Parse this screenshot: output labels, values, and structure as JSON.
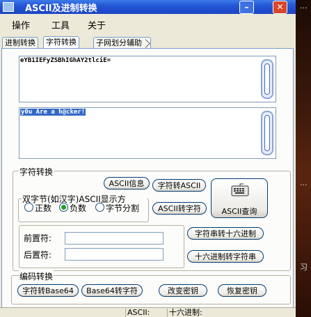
{
  "window": {
    "title": "ASCII及进制转换",
    "minimize_glyph": "–",
    "close_glyph": "✕",
    "accent": "#2457d6",
    "close_color": "#d9462a"
  },
  "menu": [
    "操作",
    "工具",
    "关于"
  ],
  "tabs": [
    {
      "label": "进制转换",
      "active": false
    },
    {
      "label": "字符转换",
      "active": true
    },
    {
      "label": "子网划分辅助",
      "active": false
    }
  ],
  "encoded_box": {
    "value": "eYB1IEFyZSBhIGhAY2tlciE="
  },
  "plain_box": {
    "value": "y0u Are a h@cker!",
    "selected": true
  },
  "char_convert": {
    "group_label": "字符转换",
    "ascii_table_button": "ASCII信息",
    "char_to_ascii_button": "字符转ASCII",
    "ascii_to_char_button": "ASCII转字符",
    "ascii_query_button": "ASCII查询",
    "double_byte": {
      "label": "双字节(如汉字)ASCII显示方",
      "options": [
        "正数",
        "负数",
        "字节分割"
      ],
      "selected": "负数"
    },
    "prefix_label": "前置符:",
    "suffix_label": "后置符:",
    "str_to_hex_button": "字符串转十六进制",
    "hex_to_str_button": "十六进制转字符串"
  },
  "encode_convert": {
    "group_label": "编码转换",
    "to_base64_button": "字符转Base64",
    "from_base64_button": "Base64转字符",
    "change_key_button": "改变密钥",
    "restore_key_button": "恢复密钥"
  },
  "statusbar": [
    "",
    "ASCII:",
    "十六进制:"
  ],
  "right_strip_marks": [
    "...",
    "...",
    "习"
  ]
}
